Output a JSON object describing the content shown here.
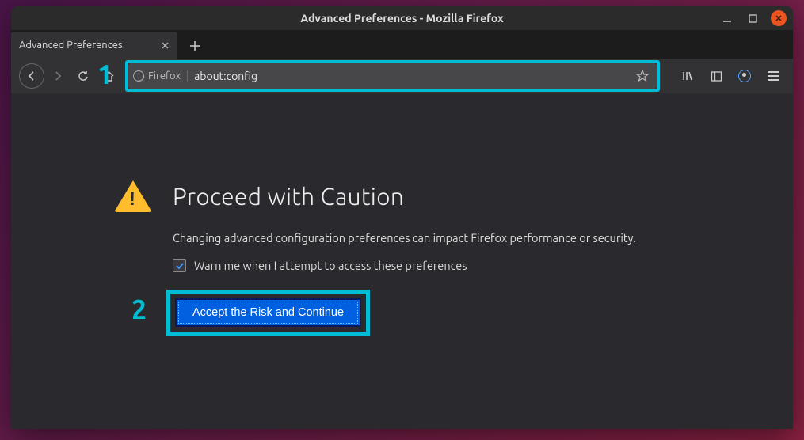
{
  "window": {
    "title": "Advanced Preferences - Mozilla Firefox"
  },
  "tab": {
    "title": "Advanced Preferences"
  },
  "urlbar": {
    "identity": "Firefox",
    "url": "about:config"
  },
  "callouts": {
    "one": "1",
    "two": "2"
  },
  "page": {
    "heading": "Proceed with Caution",
    "description": "Changing advanced configuration preferences can impact Firefox performance or security.",
    "checkbox_label": "Warn me when I attempt to access these preferences",
    "button": "Accept the Risk and Continue"
  }
}
